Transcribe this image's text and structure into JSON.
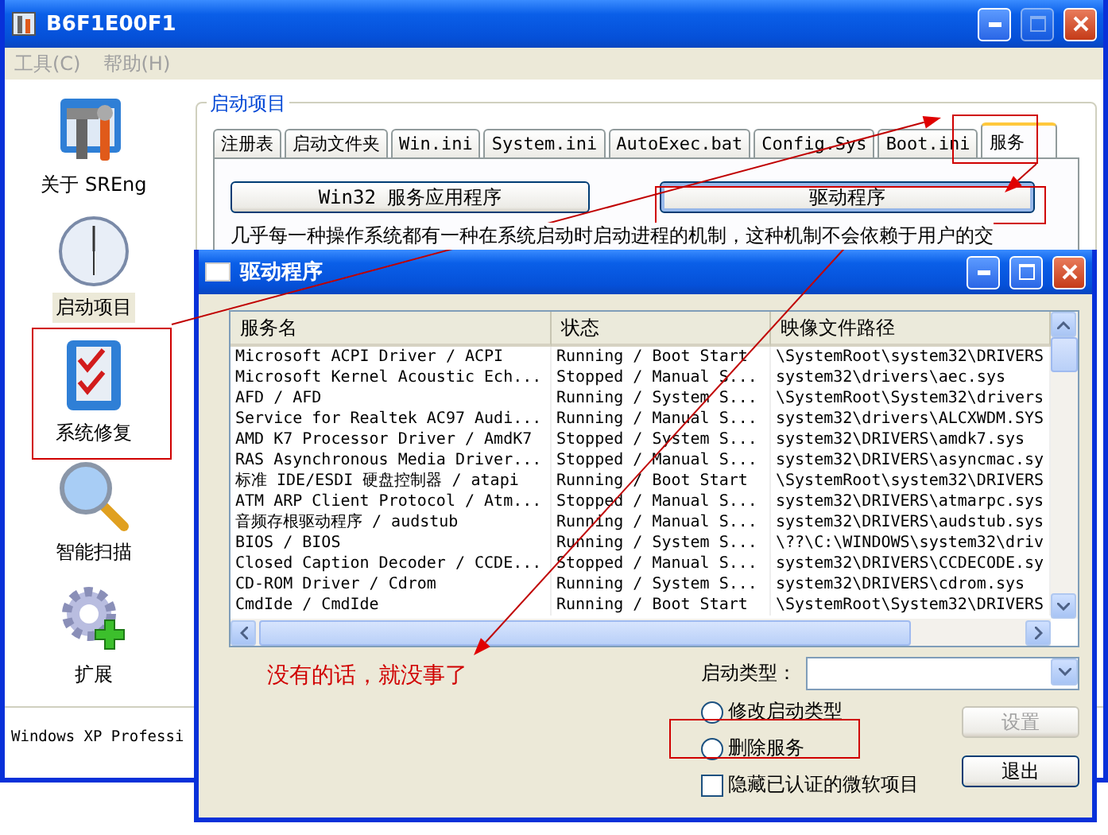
{
  "window": {
    "title": "B6F1E00F1"
  },
  "menu": [
    {
      "label": "工具(C)",
      "disabled": true
    },
    {
      "label": "帮助(H)",
      "disabled": true
    }
  ],
  "sidebar": {
    "items": [
      {
        "kind": "toolbox",
        "label": "关于 SREng",
        "selected": false
      },
      {
        "kind": "clock",
        "label": "启动项目",
        "selected": true
      },
      {
        "kind": "checklist",
        "label": "系统修复",
        "selected": false
      },
      {
        "kind": "magnifier",
        "label": "智能扫描",
        "selected": false
      },
      {
        "kind": "gear",
        "label": "扩展",
        "selected": false
      }
    ]
  },
  "group": {
    "title": "启动项目",
    "tabs": [
      {
        "label": "注册表",
        "selected": false
      },
      {
        "label": "启动文件夹",
        "selected": false
      },
      {
        "label": "Win.ini",
        "selected": false
      },
      {
        "label": "System.ini",
        "selected": false
      },
      {
        "label": "AutoExec.bat",
        "selected": false
      },
      {
        "label": "Config.Sys",
        "selected": false
      },
      {
        "label": "Boot.ini",
        "selected": false
      },
      {
        "label": "服务",
        "selected": true
      }
    ],
    "buttons": [
      {
        "label": "Win32 服务应用程序",
        "focused": false
      },
      {
        "label": "驱动程序",
        "focused": true
      }
    ],
    "description": "几乎每一种操作系统都有一种在系统启动时启动进程的机制，这种机制不会依赖于用户的交"
  },
  "status_bar": "Windows XP Professi",
  "dialog": {
    "title": "驱动程序",
    "table": {
      "columns": [
        "服务名",
        "状态",
        "映像文件路径"
      ],
      "rows": [
        [
          "Microsoft ACPI Driver / ACPI",
          "Running / Boot Start",
          "\\SystemRoot\\system32\\DRIVERS"
        ],
        [
          "Microsoft Kernel Acoustic Ech...",
          "Stopped / Manual S...",
          "system32\\drivers\\aec.sys"
        ],
        [
          "AFD / AFD",
          "Running / System S...",
          "\\SystemRoot\\System32\\drivers"
        ],
        [
          "Service for Realtek AC97 Audi...",
          "Running / Manual S...",
          "system32\\drivers\\ALCXWDM.SYS"
        ],
        [
          "AMD K7 Processor Driver / AmdK7",
          "Stopped / System S...",
          "system32\\DRIVERS\\amdk7.sys"
        ],
        [
          "RAS Asynchronous Media Driver...",
          "Stopped / Manual S...",
          "system32\\DRIVERS\\asyncmac.sy"
        ],
        [
          "标准 IDE/ESDI 硬盘控制器 / atapi",
          "Running / Boot Start",
          "\\SystemRoot\\system32\\DRIVERS"
        ],
        [
          "ATM ARP Client Protocol / Atm...",
          "Stopped / Manual S...",
          "system32\\DRIVERS\\atmarpc.sys"
        ],
        [
          "音频存根驱动程序 / audstub",
          "Running / Manual S...",
          "system32\\DRIVERS\\audstub.sys"
        ],
        [
          "BIOS / BIOS",
          "Running / System S...",
          "\\??\\C:\\WINDOWS\\system32\\driv"
        ],
        [
          "Closed Caption Decoder / CCDE...",
          "Stopped / Manual S...",
          "system32\\DRIVERS\\CCDECODE.sy"
        ],
        [
          "CD-ROM Driver / Cdrom",
          "Running / System S...",
          "system32\\DRIVERS\\cdrom.sys"
        ],
        [
          "CmdIde / CmdIde",
          "Running / Boot Start",
          "\\SystemRoot\\System32\\DRIVERS"
        ]
      ]
    },
    "startup_type": {
      "label": "启动类型："
    },
    "options": [
      {
        "kind": "radio",
        "label": "修改启动类型",
        "selected": false
      },
      {
        "kind": "radio",
        "label": "删除服务",
        "selected": false
      },
      {
        "kind": "checkbox",
        "label": "隐藏已认证的微软项目",
        "checked": false
      }
    ],
    "buttons": [
      {
        "label": "设置",
        "disabled": true
      },
      {
        "label": "退出",
        "disabled": false
      }
    ]
  },
  "annotation": {
    "note": "没有的话，就没事了"
  }
}
